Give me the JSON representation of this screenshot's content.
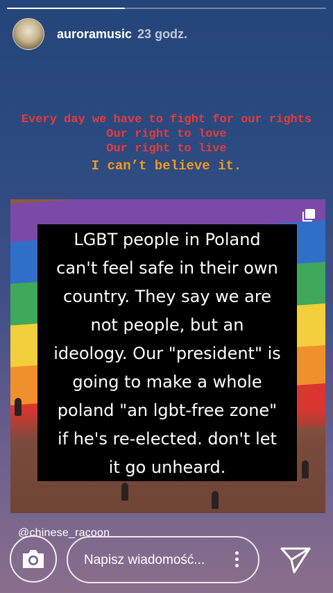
{
  "story": {
    "progress": 0.37,
    "username": "auroramusic",
    "time": "23 godz.",
    "red_lines": [
      "Every day we have to fight for our rights",
      "Our right to love",
      "Our right to live"
    ],
    "orange_line": "I can’t believe it.",
    "card_lines": [
      "LGBT people in Poland",
      "can't feel safe in their own",
      "country. They say we are",
      "not people, but an",
      "ideology. Our \"president\" is",
      "going to make a whole",
      "poland \"an lgbt-free zone\"",
      "if he's re-elected. don't let",
      "it go unheard."
    ],
    "mention": "@chinese_racoon"
  },
  "footer": {
    "message_placeholder": "Napisz wiadomość...",
    "camera_icon": "camera-icon",
    "more_icon": "more-vertical-icon",
    "send_icon": "send-icon"
  },
  "colors": {
    "red_text": "#e83a3a",
    "orange_text": "#f19a1e",
    "card_background": "#000000"
  }
}
